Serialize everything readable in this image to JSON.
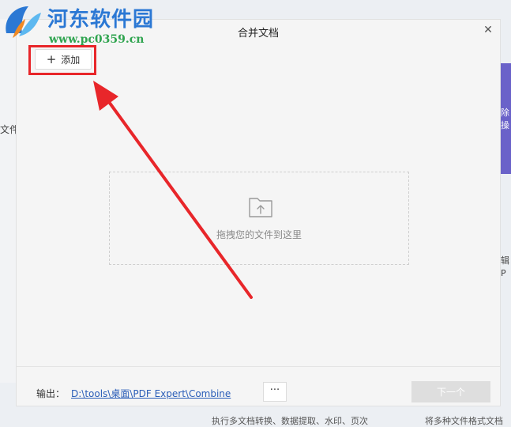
{
  "watermark": {
    "title": "河东软件园",
    "url": "www.pc0359.cn"
  },
  "background": {
    "left_text": "文件",
    "right_purple_text": "除\n操",
    "right_gray_text": "辑\nP",
    "bottom_left_text": "执行多文档转换、数据提取、水印、页次",
    "bottom_right_text": "将多种文件格式文档"
  },
  "dialog": {
    "title": "合并文档",
    "close_icon": "close-icon",
    "add_button_label": "添加",
    "dropzone": {
      "icon": "folder-upload-icon",
      "text": "拖拽您的文件到这里"
    },
    "footer": {
      "output_label": "输出：",
      "output_path": "D:\\tools\\桌面\\PDF Expert\\Combine",
      "more_button_label": "···",
      "next_button_label": "下一个"
    }
  },
  "annotation": {
    "highlight_color": "#e8262a"
  }
}
